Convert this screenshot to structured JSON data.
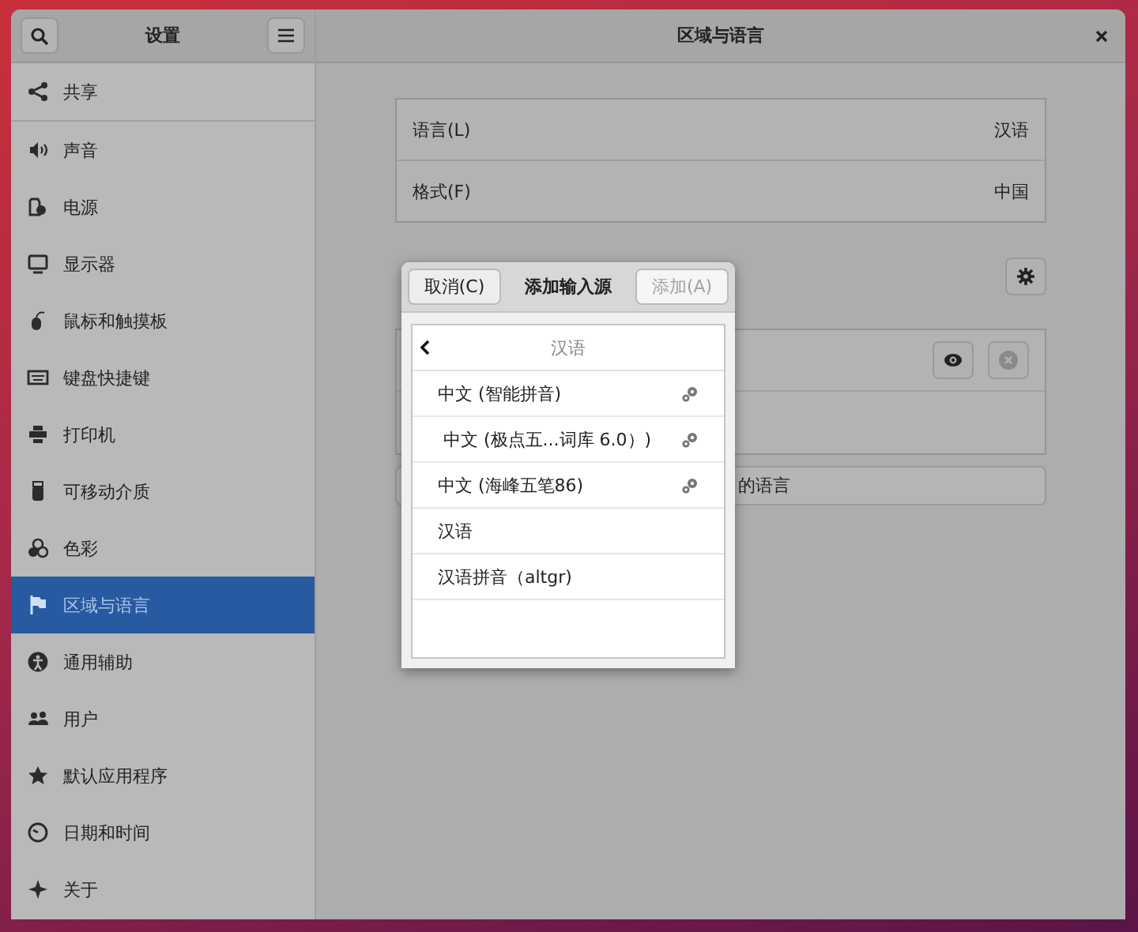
{
  "sidebar": {
    "title": "设置",
    "items": [
      {
        "label": "共享",
        "selected": false
      },
      {
        "label": "声音",
        "selected": false
      },
      {
        "label": "电源",
        "selected": false
      },
      {
        "label": "显示器",
        "selected": false
      },
      {
        "label": "鼠标和触摸板",
        "selected": false
      },
      {
        "label": "键盘快捷键",
        "selected": false
      },
      {
        "label": "打印机",
        "selected": false
      },
      {
        "label": "可移动介质",
        "selected": false
      },
      {
        "label": "色彩",
        "selected": false
      },
      {
        "label": "区域与语言",
        "selected": true
      },
      {
        "label": "通用辅助",
        "selected": false
      },
      {
        "label": "用户",
        "selected": false
      },
      {
        "label": "默认应用程序",
        "selected": false
      },
      {
        "label": "日期和时间",
        "selected": false
      },
      {
        "label": "关于",
        "selected": false
      }
    ]
  },
  "window": {
    "title": "区域与语言"
  },
  "settings": [
    {
      "label": "语言(L)",
      "value": "汉语"
    },
    {
      "label": "格式(F)",
      "value": "中国"
    }
  ],
  "languages_button": "的语言",
  "dialog": {
    "cancel": "取消(C)",
    "title": "添加输入源",
    "add": {
      "label": "添加(A)",
      "disabled": true
    },
    "language": "汉语",
    "sources": [
      {
        "label": "中文 (智能拼音)",
        "has_settings": true
      },
      {
        "label": " 中文 (极点五...词库 6.0）)",
        "has_settings": true
      },
      {
        "label": "中文 (海峰五笔86)",
        "has_settings": true
      },
      {
        "label": "汉语",
        "has_settings": false
      },
      {
        "label": "汉语拼音（altgr)",
        "has_settings": false
      }
    ]
  }
}
